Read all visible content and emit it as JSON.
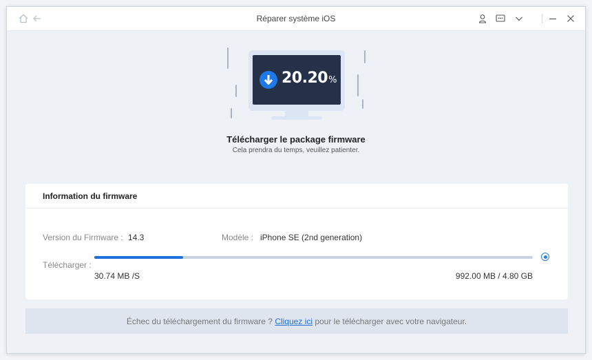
{
  "window": {
    "title": "Réparer système iOS"
  },
  "titlebar": {
    "icons": [
      "home-icon",
      "back-arrow-icon",
      "user-icon",
      "feedback-icon",
      "chevron-down-icon",
      "minimize-icon",
      "close-icon"
    ]
  },
  "download": {
    "percent_value": "20.20",
    "percent_sign": "%",
    "progress": 0.202,
    "title": "Télécharger le package firmware",
    "subtitle": "Cela prendra du temps, veuillez patienter."
  },
  "firmware_info": {
    "heading": "Information du firmware",
    "version_label": "Version du Firmware :",
    "version_value": "14.3",
    "model_label": "Modèle :",
    "model_value": "iPhone SE (2nd generation)",
    "download_label": "Télécharger :",
    "speed": "30.74 MB /S",
    "size_progress": "992.00 MB / 4.80 GB"
  },
  "footer": {
    "text_before": "Échec du téléchargement du firmware ? ",
    "link": "Cliquez ici",
    "text_after": " pour le télécharger avec votre navigateur."
  },
  "colors": {
    "accent": "#1f6fdc",
    "screen_bg": "#243149",
    "track": "#c9d3e0"
  }
}
